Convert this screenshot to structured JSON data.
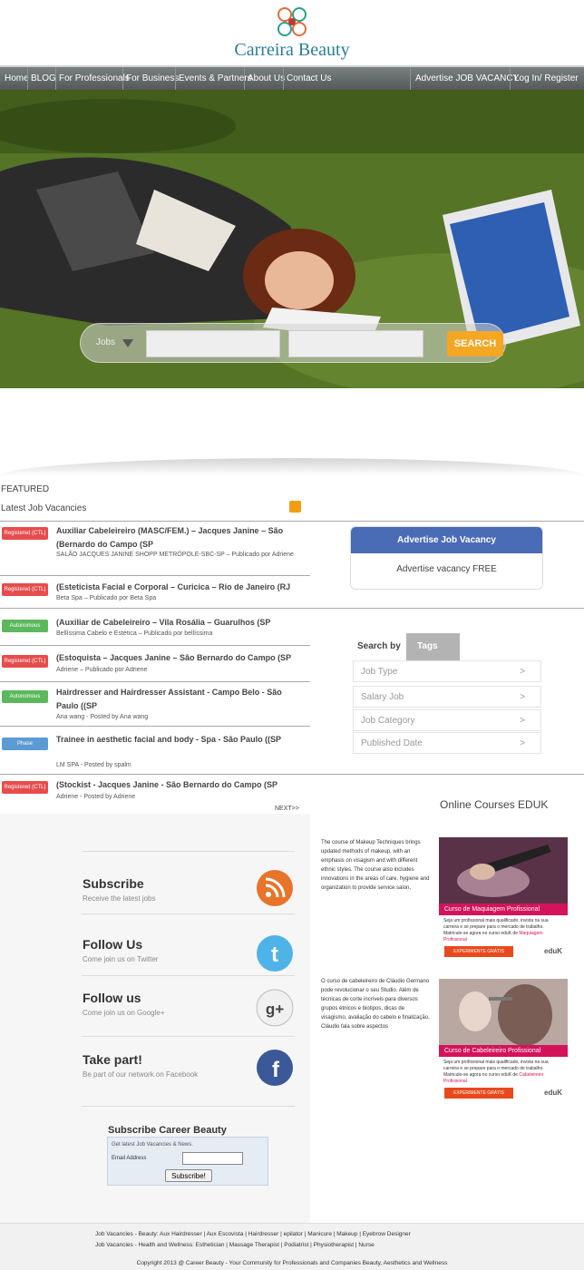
{
  "brand": {
    "name": "Carreira Beauty"
  },
  "nav": {
    "items": [
      "Home",
      "BLOG",
      "For Professionals",
      "For Business",
      "Events & Partners",
      "About Us",
      "Contact Us"
    ],
    "right": [
      "Advertise JOB VACANCY",
      "Log In/ Register"
    ]
  },
  "search": {
    "category": "Jobs",
    "button": "SEARCH",
    "keyword_value": "",
    "location_value": ""
  },
  "featured": {
    "label": "FEATURED",
    "latest": "Latest Job Vacancies",
    "next": "NEXT>>"
  },
  "jobs": [
    {
      "badge": "Registered (CTL)",
      "title": "Auxiliar Cabeleireiro (MASC/FEM.) – Jacques Janine – São (Bernardo do Campo (SP",
      "meta": "SALÃO JACQUES JANINE SHOPP METRÓPOLE-SBC-SP – Publicado por Adriene"
    },
    {
      "badge": "Registered (CTL)",
      "title": "(Esteticista Facial e Corporal – Curicica – Rio de Janeiro (RJ",
      "meta": "Beta Spa – Publicado por Beta Spa"
    },
    {
      "badge": "Autonomous",
      "title": "(Auxiliar de Cabeleireiro – Vila Rosália – Guarulhos (SP",
      "meta": "Bellíssima Cabelo e Estética – Publicado por bellíssima"
    },
    {
      "badge": "Registered (CTL)",
      "title": "(Estoquista – Jacques Janine – São Bernardo do Campo (SP",
      "meta": "Adriene – Publicado por Adriene"
    },
    {
      "badge": "Autonomous",
      "title": "Hairdresser and Hairdresser Assistant - Campo Belo - São Paulo ((SP",
      "meta": "Ana wang - Posted by Ana wang"
    },
    {
      "badge": "Phase",
      "title": "Trainee in aesthetic facial and body - Spa - São Paulo ((SP",
      "meta": "LM SPA - Posted by spalm"
    },
    {
      "badge": "Registered (CTL)",
      "title": "(Stockist - Jacques Janine - São Bernardo do Campo (SP",
      "meta": "Adriene - Posted by Adriene"
    }
  ],
  "advertise": {
    "title": "Advertise Job Vacancy",
    "free": "Advertise vacancy FREE"
  },
  "filters": {
    "tab_search": "Search by",
    "tab_tags": "Tags",
    "items": [
      "Job Type",
      "Salary Job",
      "Job Category",
      "Published Date"
    ]
  },
  "online_courses": "Online Courses EDUK",
  "social": [
    {
      "title": "Subscribe",
      "sub": "Receive the latest jobs"
    },
    {
      "title": "Follow Us",
      "sub": "Come join us on Twitter"
    },
    {
      "title": "Follow us",
      "sub": "Come join us on Google+"
    },
    {
      "title": "Take part!",
      "sub": "Be part of our network on Facebook"
    }
  ],
  "subscribe_form": {
    "title": "Subscribe Career Beauty",
    "note": "Get latest Job Vacancies & News.",
    "email_label": "Email Address",
    "button": "Subscribe!"
  },
  "courses": [
    {
      "text": "The course of Makeup Techniques brings updated methods of makeup, with an emphasis on visagism and with different ethnic styles. The course also includes innovations in the areas of care, hygiene and organization to provide service salon,",
      "banner": "Curso de Maquiagem Profissional",
      "body": "Seja um profissional mais qualificado, invista na sua carreira e se prepare para o mercado de trabalho. Matricule-se agora no curso eduK de",
      "course_name": "Maquiagem Profissional",
      "cta": "EXPERIMENTE GRÁTIS",
      "brand": "eduK"
    },
    {
      "text": "O curso de cabeleireiro de Cláudio Germano pode revolucionar o seu Studio. Além de técnicas de corte incríveis para diversos grupos étnicos e biotipos, dicas de visagismo, avaliação do cabelo e finalização, Cláudio fala sobre aspectos",
      "banner": "Curso de Cabeleireiro Profissional",
      "body": "Seja um profissional mais qualificado, invista na sua carreira e se prepare para o mercado de trabalho. Matricule-se agora no curso eduK de",
      "course_name": "Cabeleireiro Profissional",
      "cta": "EXPERIMENTE GRÁTIS",
      "brand": "eduK"
    }
  ],
  "footer": {
    "line1": "Job Vacancies - Beauty:  Aux Hairdresser  |  Aux Escovista  |  Hairdresser  |  epilator  |  Manicure  |  Makeup  |  Eyebrow Designer",
    "line2": "Job Vacancies - Health and Wellness:  Esthetician  |  Massage Therapist  |  Podiatrist  |  Physiotherapist  |  Nurse",
    "copyright": "Copyright 2013 @ Career Beauty - Your Community for Professionals and Companies Beauty, Aesthetics and Wellness"
  },
  "colors": {
    "nav": "#666b6c",
    "search_button": "#f5a623",
    "advertise": "#4a6bb5",
    "registered": "#e74c4c",
    "autonomous": "#5cb85c",
    "phase": "#5b9bd5"
  }
}
